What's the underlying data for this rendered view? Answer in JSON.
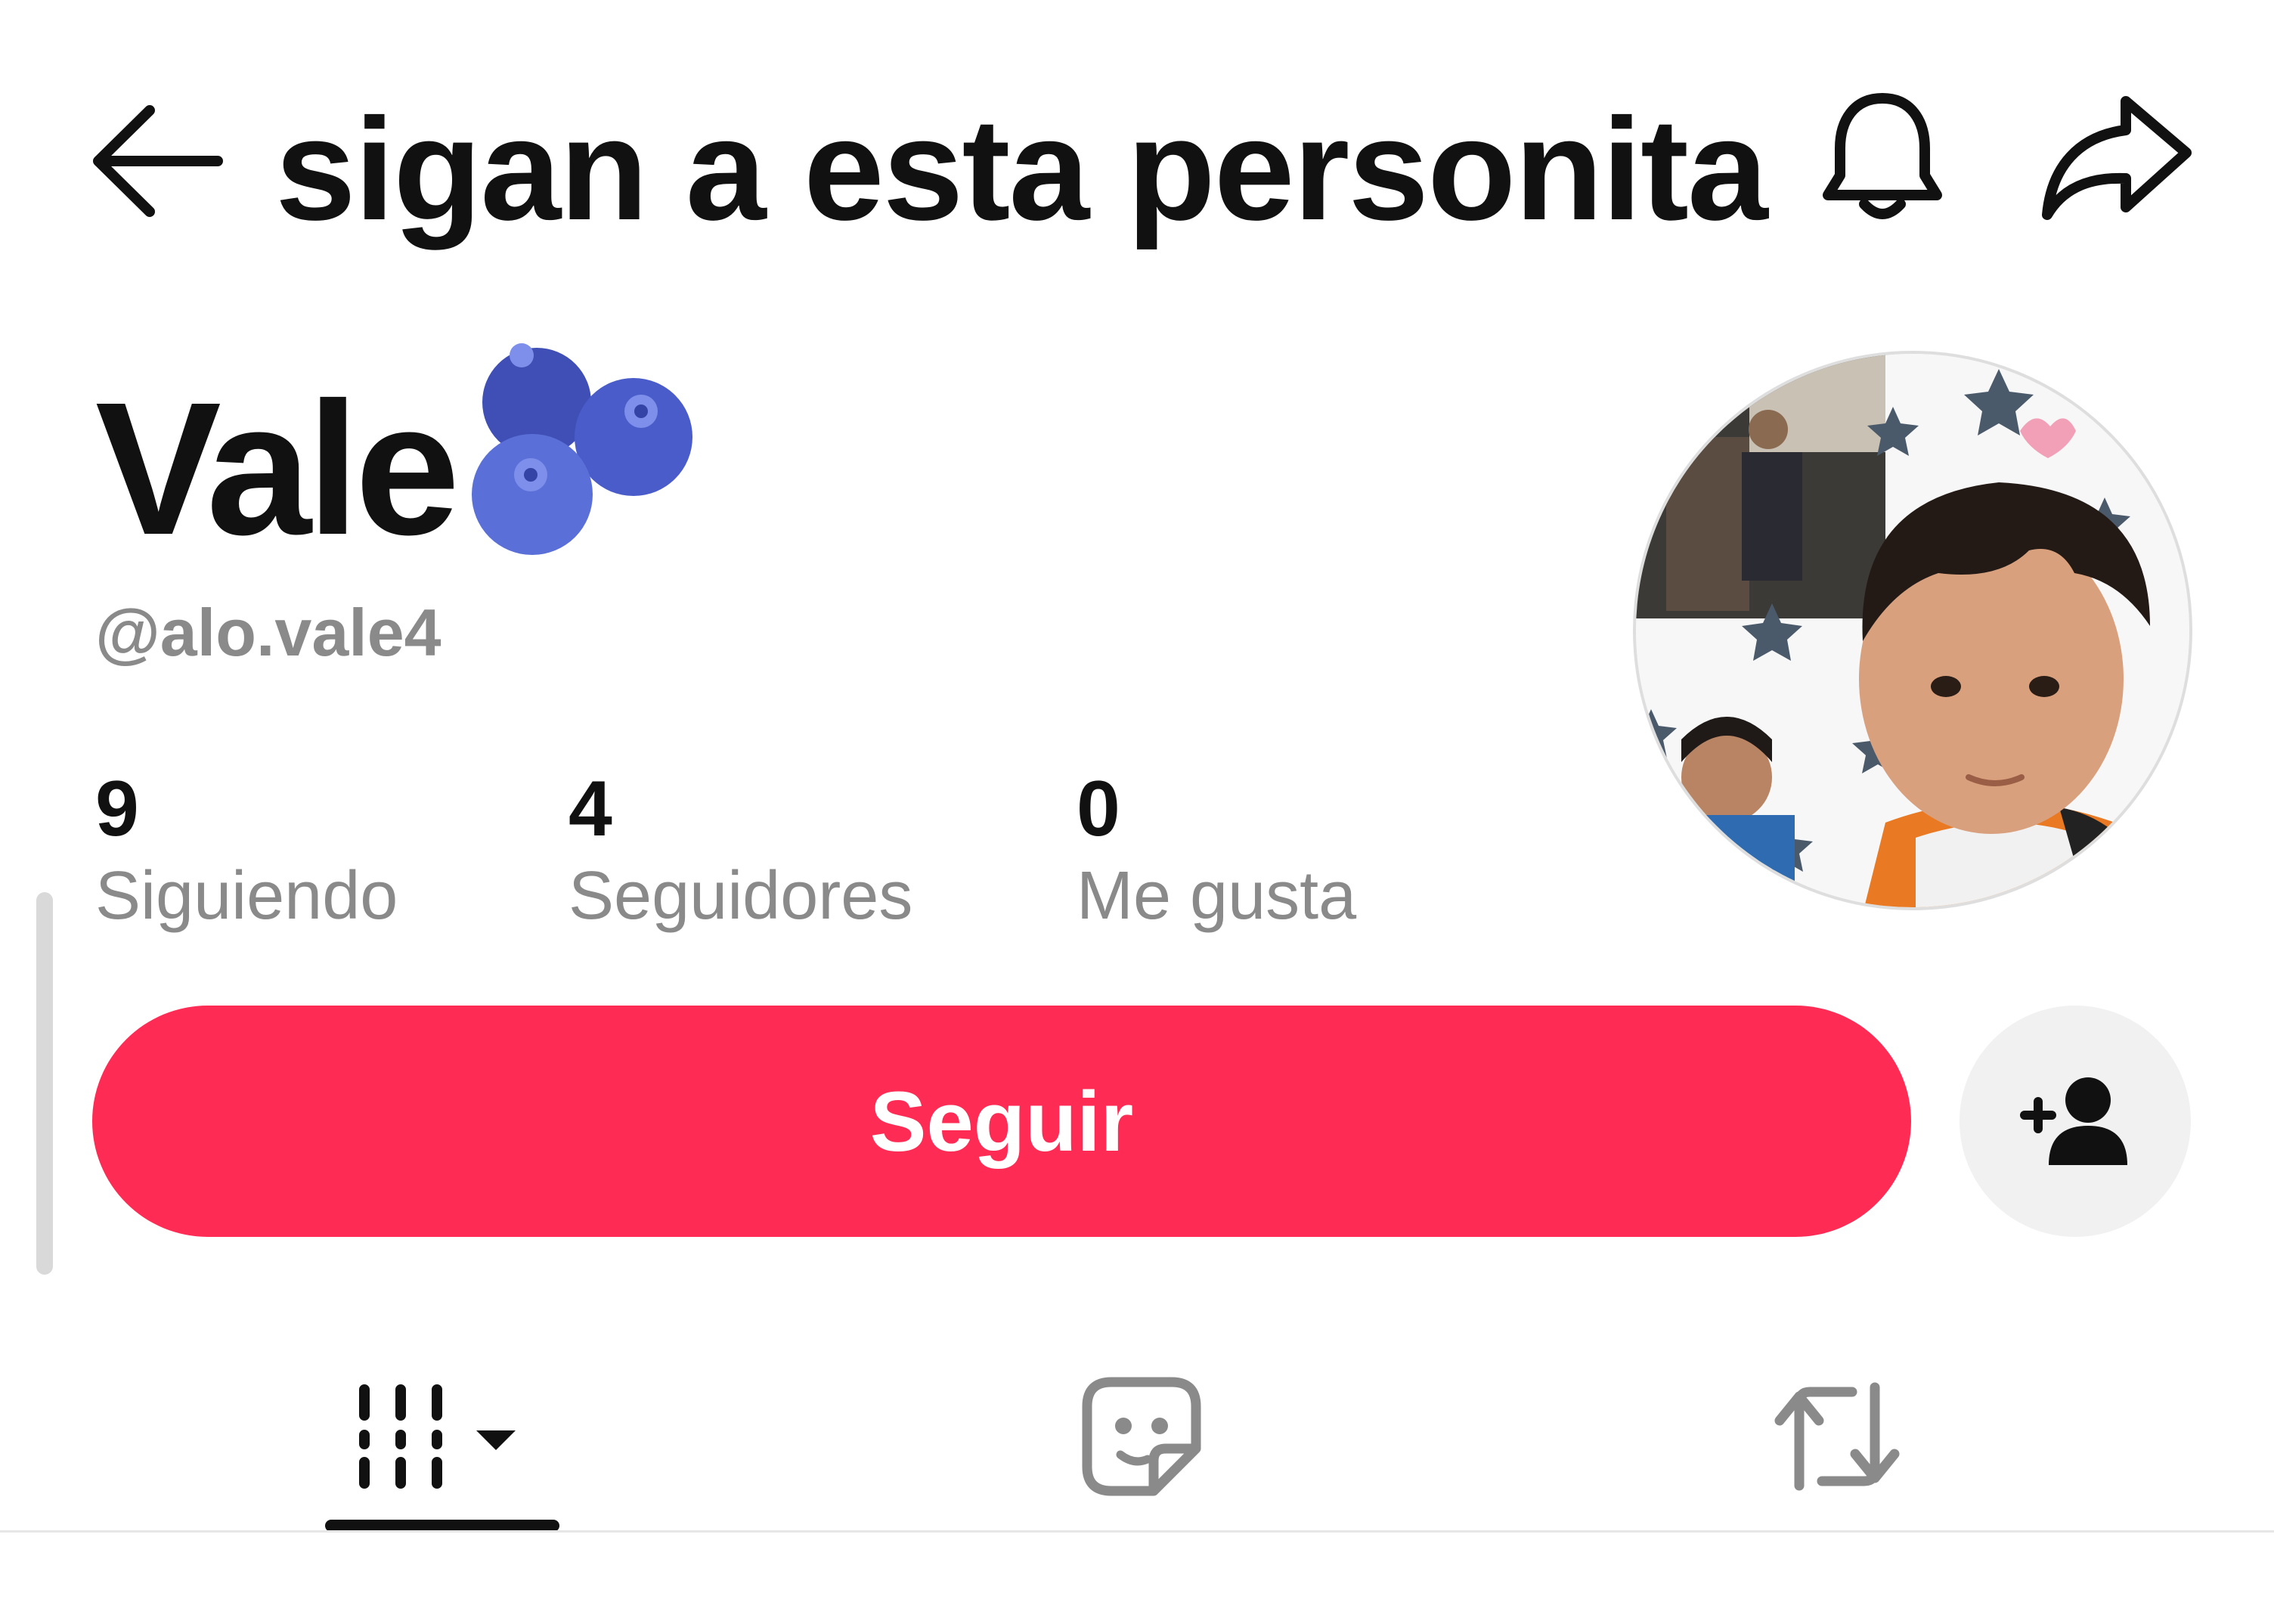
{
  "header": {
    "title": "sigan a esta personita",
    "back_icon": "back-arrow-icon",
    "bell_icon": "bell-icon",
    "share_icon": "share-icon"
  },
  "profile": {
    "display_name": "Vale",
    "emoji": "blueberries-emoji",
    "username": "@alo.vale4",
    "avatar": "profile-avatar-photo"
  },
  "stats": {
    "following": {
      "value": "9",
      "label": "Siguiendo"
    },
    "followers": {
      "value": "4",
      "label": "Seguidores"
    },
    "likes": {
      "value": "0",
      "label": "Me gusta"
    }
  },
  "actions": {
    "follow_label": "Seguir",
    "add_friend_icon": "add-user-icon"
  },
  "tabs": [
    {
      "name": "videos",
      "icon": "video-grid-icon",
      "selected": true
    },
    {
      "name": "favorites",
      "icon": "sticker-icon",
      "selected": false
    },
    {
      "name": "reposts",
      "icon": "repost-icon",
      "selected": false
    }
  ],
  "colors": {
    "accent": "#fe2c55",
    "text": "#111111",
    "muted": "#8a8a8a",
    "icon_muted": "#8a8a8a",
    "button_bg": "#f1f1f2"
  }
}
